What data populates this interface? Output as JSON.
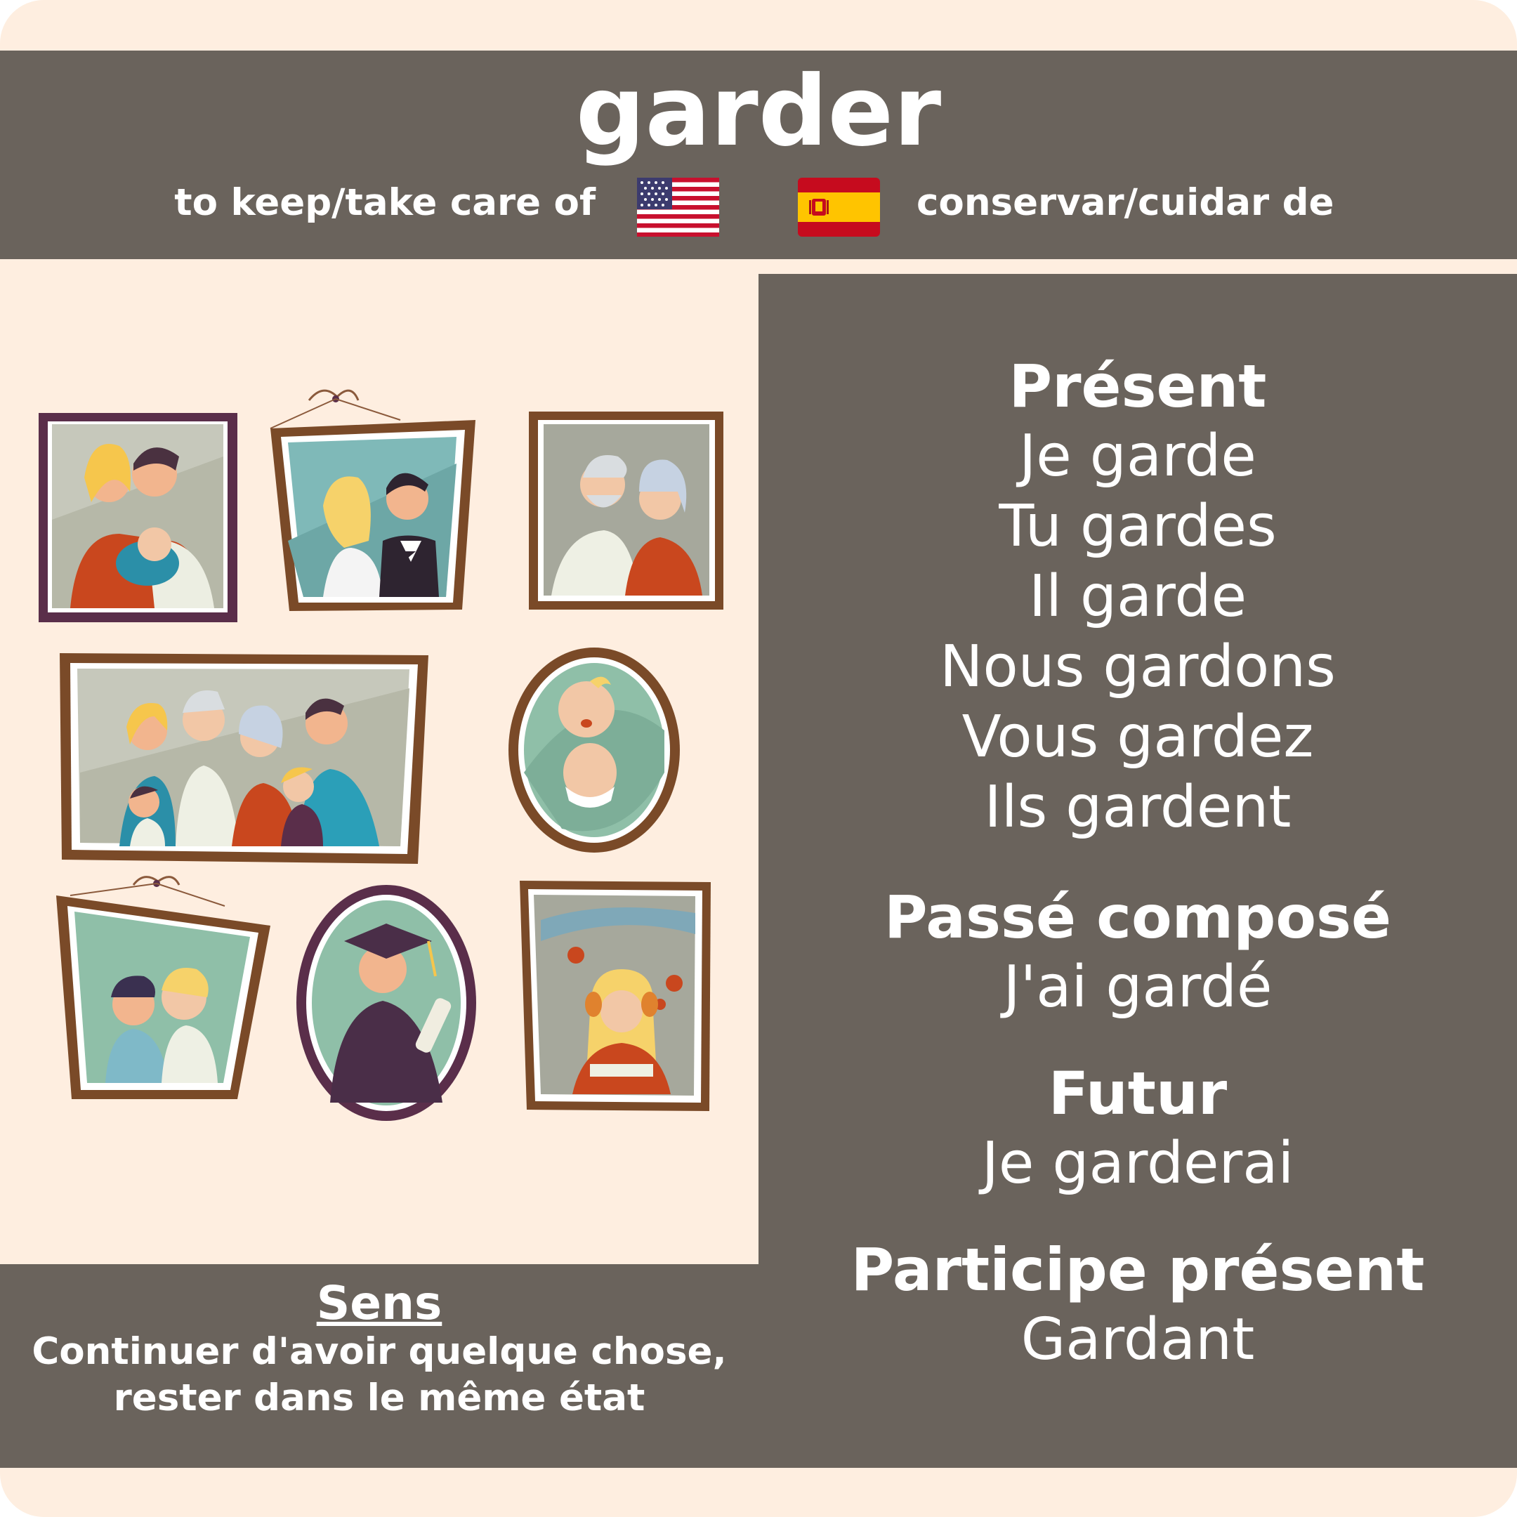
{
  "header": {
    "verb": "garder",
    "translation_en": "to keep/take care of",
    "translation_es": "conservar/cuidar de",
    "flag_en_icon": "us-flag-icon",
    "flag_es_icon": "spain-flag-icon"
  },
  "colors": {
    "card_background": "#feeee0",
    "panel_background": "#6a635c",
    "text": "#ffffff"
  },
  "illustration": {
    "icon": "family-photo-frames-illustration"
  },
  "conjugation": {
    "present": {
      "title": "Présent",
      "forms": [
        "Je garde",
        "Tu gardes",
        "Il garde",
        "Nous gardons",
        "Vous gardez",
        "Ils gardent"
      ]
    },
    "passe_compose": {
      "title": "Passé composé",
      "form": "J'ai gardé"
    },
    "futur": {
      "title": "Futur",
      "form": "Je garderai"
    },
    "participe_present": {
      "title": "Participe présent",
      "form": "Gardant"
    }
  },
  "sens": {
    "title": "Sens",
    "lines": [
      "Continuer d'avoir quelque chose,",
      "rester dans le même état"
    ]
  }
}
